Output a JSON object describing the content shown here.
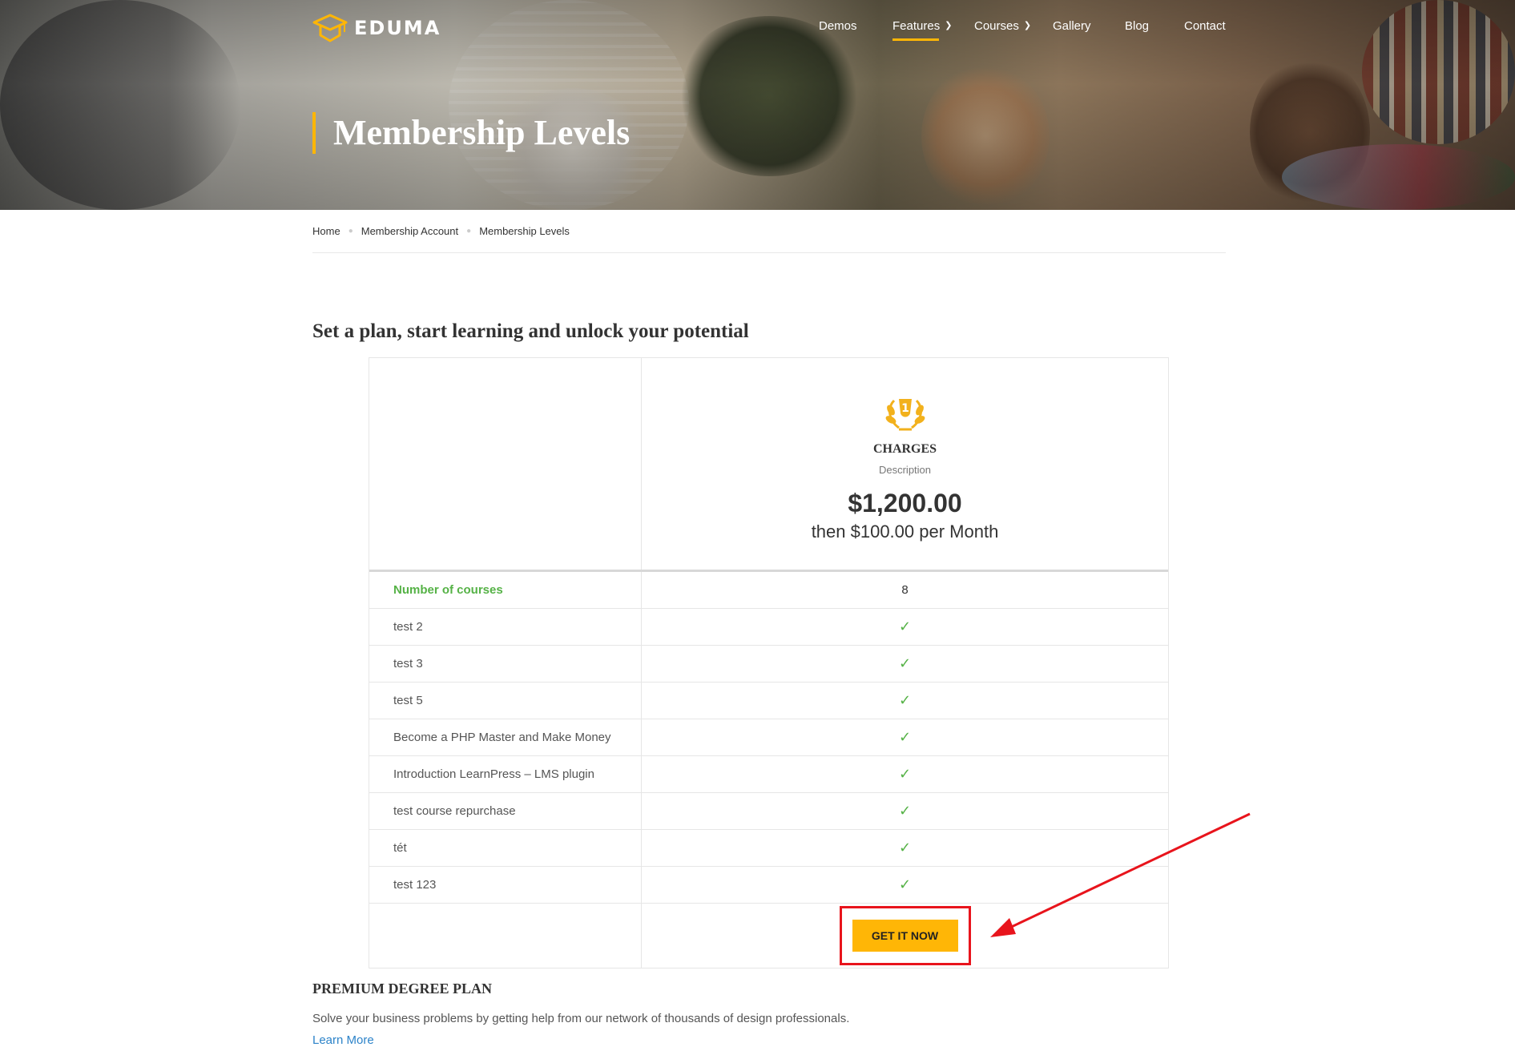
{
  "header": {
    "logo_text": "EDUMA",
    "nav": [
      {
        "label": "Demos"
      },
      {
        "label": "Features"
      },
      {
        "label": "Courses"
      },
      {
        "label": "Gallery"
      },
      {
        "label": "Blog"
      },
      {
        "label": "Contact"
      }
    ],
    "active_nav": "Features",
    "accent_color": "#ffb606"
  },
  "hero": {
    "title": "Membership Levels"
  },
  "breadcrumb": [
    "Home",
    "Membership Account",
    "Membership Levels"
  ],
  "main": {
    "section_title": "Set a plan, start learning and unlock your potential",
    "plan": {
      "badge_icon": "laurel-number-1-icon",
      "name": "CHARGES",
      "description": "Description",
      "price": "$1,200.00",
      "recurring": "then $100.00 per Month",
      "button_label": "GET IT NOW"
    },
    "features": [
      {
        "label": "Number of courses",
        "value": "8",
        "highlight": true
      },
      {
        "label": "test 2",
        "value": "✓"
      },
      {
        "label": "test 3",
        "value": "✓"
      },
      {
        "label": "test 5",
        "value": "✓"
      },
      {
        "label": "Become a PHP Master and Make Money",
        "value": "✓"
      },
      {
        "label": "Introduction LearnPress – LMS plugin",
        "value": "✓"
      },
      {
        "label": "test course repurchase",
        "value": "✓"
      },
      {
        "label": "tét",
        "value": "✓"
      },
      {
        "label": "test 123",
        "value": "✓"
      }
    ],
    "annotation_color": "#e8141c"
  },
  "premium": {
    "title": "PREMIUM DEGREE PLAN",
    "description": "Solve your business problems by getting help from our network of thousands of design professionals.",
    "link_label": "Learn More"
  }
}
